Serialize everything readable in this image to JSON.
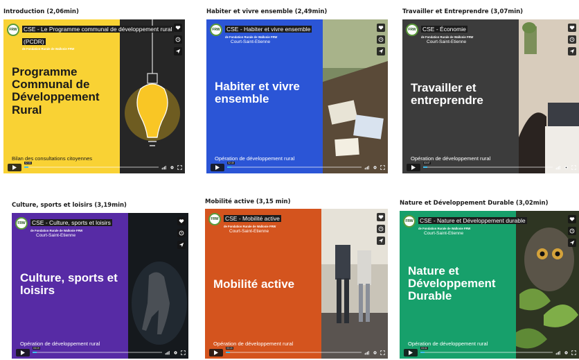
{
  "brand": {
    "logo_text": "FRW",
    "org_line": "de Fondation Rurale de Wallonie FRW",
    "location": "Court-Saint-Etienne"
  },
  "cards": [
    {
      "title": "Introduction (2,06min)",
      "player_title": "CSE - Le Programme communal de développement rural (PCDR)",
      "big_text": "Programme Communal de Développement Rural",
      "bottom_text": "Bilan des consultations citoyennes",
      "time": "02:00",
      "panel_color": "#f9d234",
      "photo_color": "#2b2b2b",
      "header_bg": "#1c1c1c",
      "big_color": "#1a1a1a",
      "bottom_color": "#1a1a1a",
      "show_location": false
    },
    {
      "title": "Habiter et vivre ensemble (2,49min)",
      "player_title": "CSE - Habiter et vivre ensemble",
      "big_text": "Habiter et vivre ensemble",
      "bottom_text": "Opération de développement rural",
      "time": "02:49",
      "panel_color": "#2b55d6",
      "photo_color": "#6a7a55",
      "header_bg": "#1c1c1c",
      "big_color": "#ffffff",
      "bottom_color": "#ffffff",
      "show_location": true
    },
    {
      "title": "Travailler et Entreprendre (3,07min)",
      "player_title": "CSE - Économie",
      "big_text": "Travailler et entreprendre",
      "bottom_text": "Opération de développement rural",
      "time": "03:07",
      "panel_color": "#3c3c3c",
      "photo_color": "#c9b9a5",
      "header_bg": "#1c1c1c",
      "big_color": "#ffffff",
      "bottom_color": "#ffffff",
      "show_location": true
    },
    {
      "title": "Culture, sports et loisirs (3,19min)",
      "player_title": "CSE - Culture, sports et loisirs",
      "big_text": "Culture, sports et loisirs",
      "bottom_text": "Opération de développement rural",
      "time": "03:19",
      "panel_color": "#572ba5",
      "photo_color": "#15191d",
      "header_bg": "#1c1c1c",
      "big_color": "#ffffff",
      "bottom_color": "#ffffff",
      "show_location": true
    },
    {
      "title": "Mobilité active (3,15 min)",
      "player_title": "CSE - Mobilité active",
      "big_text": "Mobilité active",
      "bottom_text": "Opération de développement rural",
      "time": "03:15",
      "panel_color": "#d4541e",
      "photo_color": "#7a6f62",
      "header_bg": "#1c1c1c",
      "big_color": "#ffffff",
      "bottom_color": "#ffffff",
      "show_location": true
    },
    {
      "title": "Nature et Développement Durable (3,02min)",
      "player_title": "CSE - Nature et Développement durable",
      "big_text": "Nature et Développement Durable",
      "bottom_text": "Opération de développement rural",
      "time": "03:02",
      "panel_color": "#17a06b",
      "photo_color": "#3e4a2e",
      "header_bg": "#1c1c1c",
      "big_color": "#ffffff",
      "bottom_color": "#ffffff",
      "show_location": true
    }
  ],
  "icons": {
    "like": "heart-icon",
    "later": "clock-icon",
    "share": "share-icon",
    "play": "play-icon",
    "volume": "volume-icon",
    "settings": "gear-icon",
    "fullscreen": "fullscreen-icon"
  },
  "accent": "#3fc0f0"
}
